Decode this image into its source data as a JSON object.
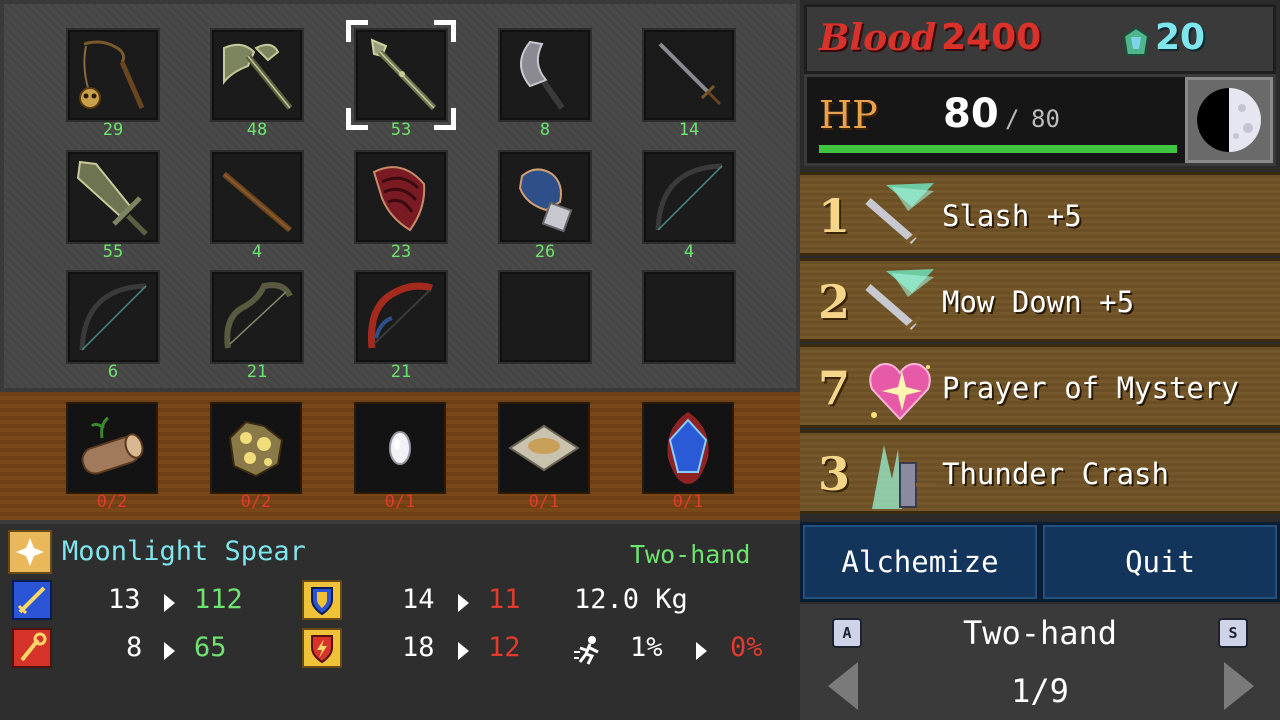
{
  "inventory": {
    "rows": [
      [
        {
          "icon": "flail-icon",
          "count": "29"
        },
        {
          "icon": "axe-icon",
          "count": "48"
        },
        {
          "icon": "spear-icon",
          "count": "53",
          "selected": true
        },
        {
          "icon": "blade-icon",
          "count": "8"
        },
        {
          "icon": "sword-icon",
          "count": "14"
        }
      ],
      [
        {
          "icon": "greatsword-icon",
          "count": "55"
        },
        {
          "icon": "staff-icon",
          "count": "4"
        },
        {
          "icon": "claw-icon",
          "count": "23"
        },
        {
          "icon": "gauntlet-icon",
          "count": "26"
        },
        {
          "icon": "bow-icon",
          "count": "4"
        }
      ],
      [
        {
          "icon": "bow-icon",
          "count": "6"
        },
        {
          "icon": "recurve-bow-icon",
          "count": "21"
        },
        {
          "icon": "red-bow-icon",
          "count": "21"
        },
        {
          "icon": "",
          "count": ""
        },
        {
          "icon": "",
          "count": ""
        }
      ]
    ]
  },
  "materials": [
    {
      "icon": "log-icon",
      "count": "0/2"
    },
    {
      "icon": "gold-ore-icon",
      "count": "0/2"
    },
    {
      "icon": "crystal-icon",
      "count": "0/1"
    },
    {
      "icon": "cloth-icon",
      "count": "0/1"
    },
    {
      "icon": "blue-gem-icon",
      "count": "0/1"
    }
  ],
  "details": {
    "name": "Moonlight Spear",
    "hand_type": "Two-hand",
    "attack": {
      "from": "13",
      "to": "112"
    },
    "magic": {
      "from": "8",
      "to": "65"
    },
    "defense": {
      "from": "14",
      "to": "11"
    },
    "resist": {
      "from": "18",
      "to": "12"
    },
    "weight": "12.0 Kg",
    "speed": {
      "from": "1%",
      "to": "0%"
    }
  },
  "currency": {
    "blood_label": "Blood",
    "blood_value": "2400",
    "gem_value": "20"
  },
  "hp": {
    "label": "HP",
    "current": "80",
    "separator": "/",
    "max": "80",
    "fraction": 1.0
  },
  "skills": [
    {
      "num": "1",
      "label": "Slash +5"
    },
    {
      "num": "2",
      "label": "Mow Down +5"
    },
    {
      "num": "7",
      "label": "Prayer of Mystery"
    },
    {
      "num": "3",
      "label": "Thunder Crash"
    }
  ],
  "actions": {
    "alchemize": "Alchemize",
    "quit": "Quit"
  },
  "pager": {
    "left_key": "A",
    "right_key": "S",
    "category": "Two-hand",
    "page": "1/9"
  },
  "colors": {
    "green": "#6fe36f",
    "red": "#e23b2e",
    "cyan": "#7fe5ef",
    "blood": "#d8322b",
    "hp_bar": "#3fc43f"
  }
}
